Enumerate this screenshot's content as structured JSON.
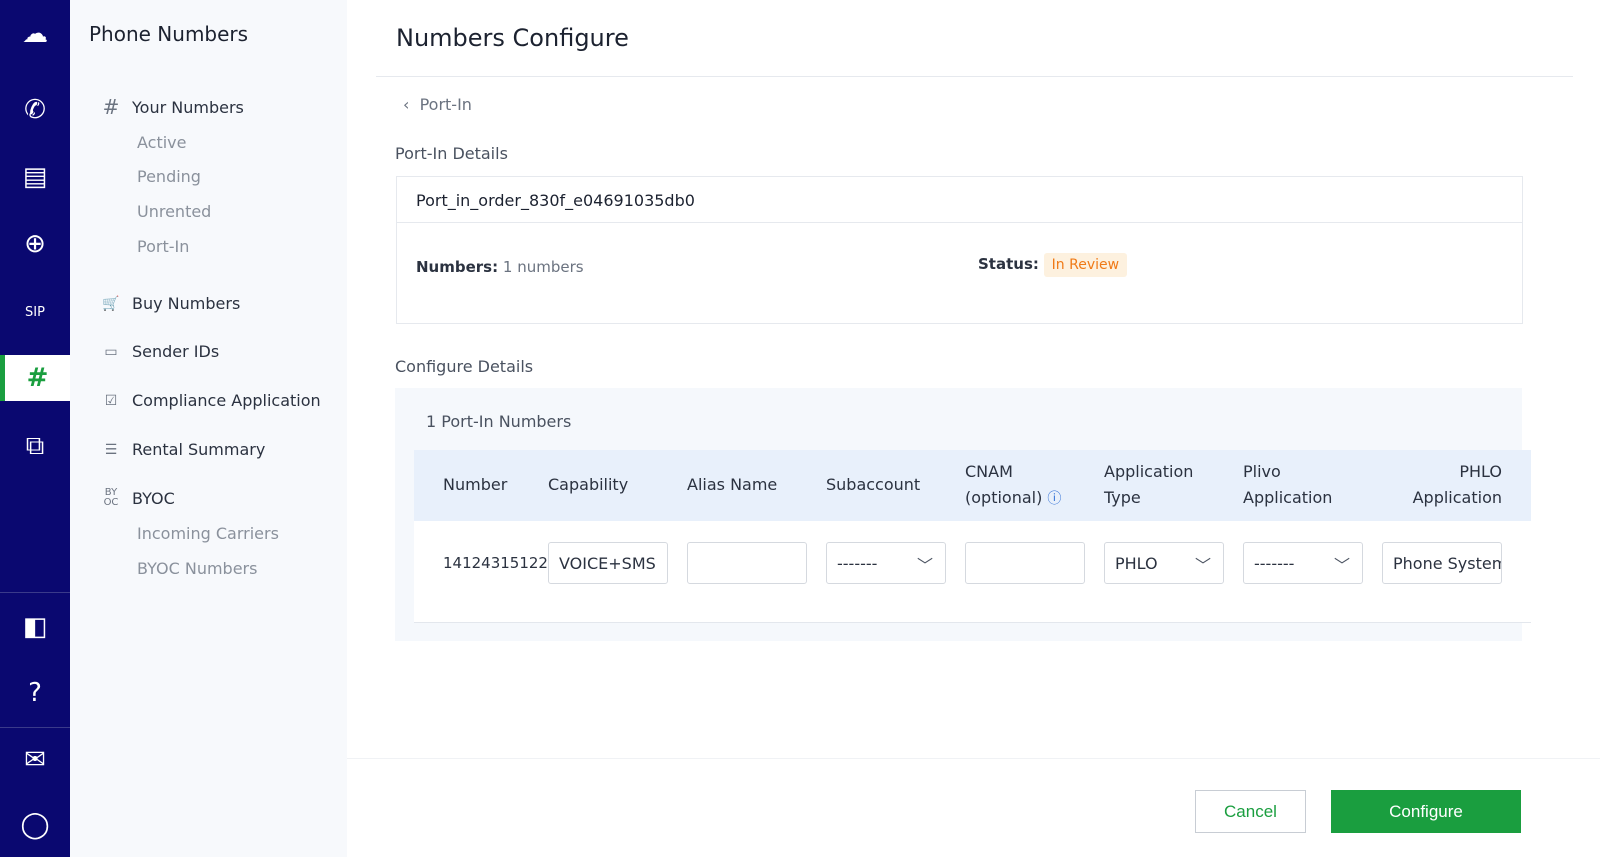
{
  "rail": {
    "items": [
      {
        "icon": "cloud-grid-icon",
        "glyph": "☁"
      },
      {
        "icon": "phone-call-icon",
        "glyph": "✆"
      },
      {
        "icon": "messages-icon",
        "glyph": "▤"
      },
      {
        "icon": "global-search-icon",
        "glyph": "⊕"
      },
      {
        "icon": "sip-icon",
        "glyph": "SIP"
      },
      {
        "icon": "hash-icon",
        "glyph": "#"
      },
      {
        "icon": "flow-icon",
        "glyph": "⧉"
      },
      {
        "icon": "docs-icon",
        "glyph": "◧"
      },
      {
        "icon": "help-icon",
        "glyph": "?"
      },
      {
        "icon": "billing-icon",
        "glyph": "✉"
      },
      {
        "icon": "profile-icon",
        "glyph": "◯"
      }
    ],
    "active_index": 5
  },
  "sidebar": {
    "title": "Phone Numbers",
    "your_numbers": "Your Numbers",
    "your_numbers_sub": [
      "Active",
      "Pending",
      "Unrented",
      "Port-In"
    ],
    "buy_numbers": "Buy Numbers",
    "sender_ids": "Sender IDs",
    "compliance": "Compliance Application",
    "rental": "Rental Summary",
    "byoc": "BYOC",
    "byoc_sub": [
      "Incoming Carriers",
      "BYOC Numbers"
    ]
  },
  "main": {
    "title": "Numbers Configure",
    "back": "Port-In",
    "details_title": "Port-In Details",
    "order_id": "Port_in_order_830f_e04691035db0",
    "numbers_label": "Numbers:",
    "numbers_value": "1 numbers",
    "status_label": "Status:",
    "status_value": "In Review",
    "status_color": "#f07a17",
    "configure_title": "Configure Details",
    "count": "1 Port-In Numbers",
    "columns": [
      "Number",
      "Capability",
      "Alias Name",
      "Subaccount",
      "CNAM",
      "(optional)",
      "Application",
      "Type",
      "Plivo",
      "Application",
      "PHLO",
      "Application"
    ],
    "row": {
      "number": "14124315122",
      "capability": "VOICE+SMS",
      "alias": "",
      "subaccount": "-------",
      "cnam": "",
      "app_type": "PHLO",
      "plivo_app": "-------",
      "phlo_app": "Phone System"
    },
    "cancel": "Cancel",
    "configure": "Configure",
    "accent": "#1a9e3f"
  }
}
